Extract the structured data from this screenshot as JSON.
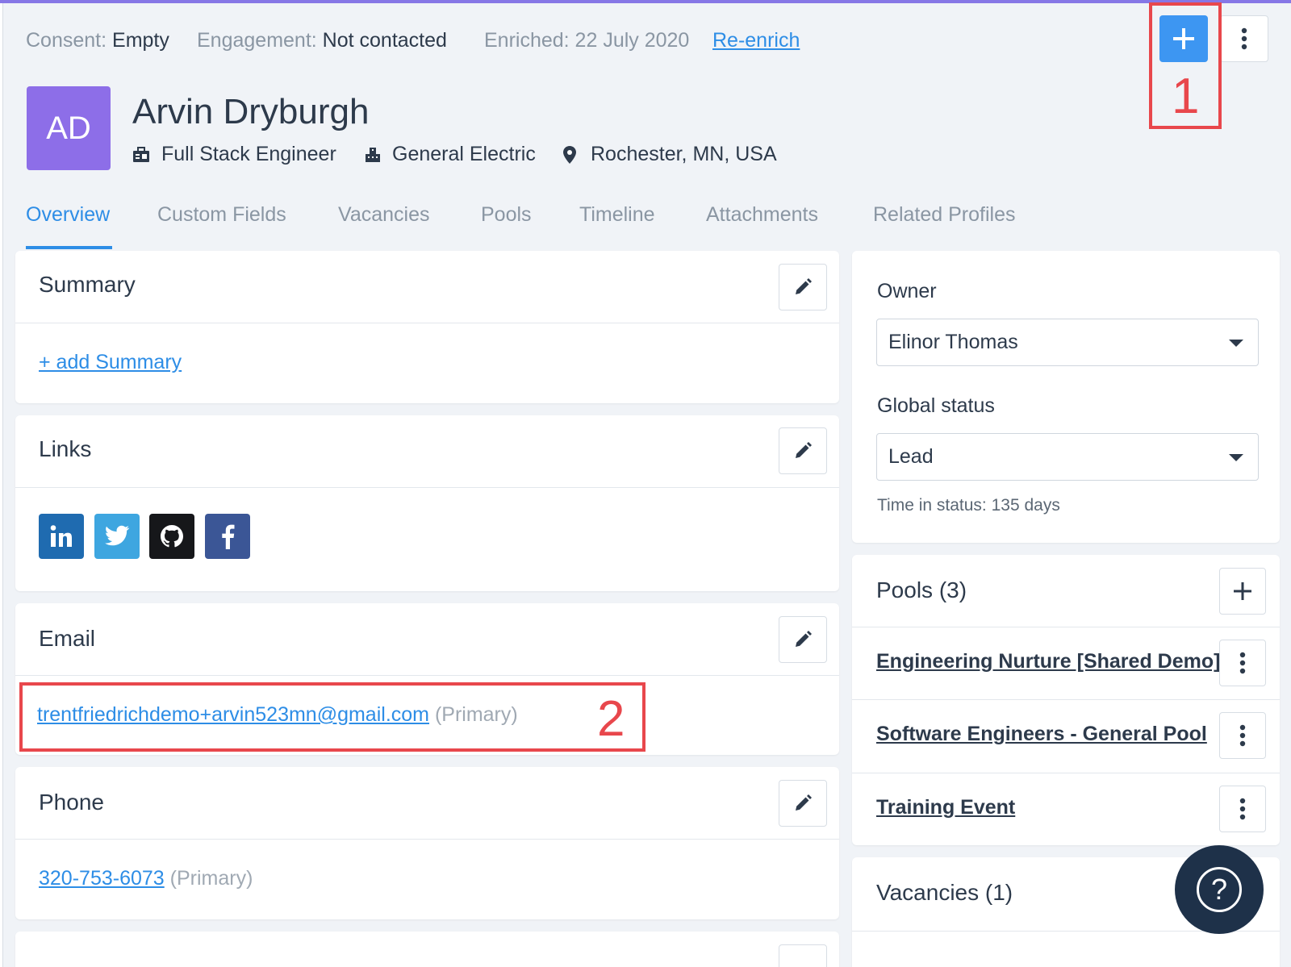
{
  "meta": {
    "consent_label": "Consent:",
    "consent_value": "Empty",
    "engagement_label": "Engagement:",
    "engagement_value": "Not contacted",
    "enriched_text": "Enriched: 22 July 2020",
    "reenrich_label": "Re-enrich"
  },
  "actions": {
    "add_icon": "plus-icon",
    "more_icon": "vertical-dots-icon"
  },
  "annotations": {
    "one": "1",
    "two": "2"
  },
  "profile": {
    "initials": "AD",
    "name": "Arvin Dryburgh",
    "title": "Full Stack Engineer",
    "company": "General Electric",
    "location": "Rochester, MN, USA"
  },
  "tabs": [
    "Overview",
    "Custom Fields",
    "Vacancies",
    "Pools",
    "Timeline",
    "Attachments",
    "Related Profiles"
  ],
  "summary": {
    "title": "Summary",
    "add_label": "+ add Summary"
  },
  "links": {
    "title": "Links",
    "items": [
      "linkedin-icon",
      "twitter-icon",
      "github-icon",
      "facebook-icon"
    ]
  },
  "email": {
    "title": "Email",
    "address": "trentfriedrichdemo+arvin523mn@gmail.com",
    "tag": "(Primary)"
  },
  "phone": {
    "title": "Phone",
    "number": "320-753-6073",
    "tag": "(Primary)"
  },
  "owner": {
    "label": "Owner",
    "value": "Elinor Thomas"
  },
  "global_status": {
    "label": "Global status",
    "value": "Lead",
    "time_in_status": "Time in status: 135 days"
  },
  "pools": {
    "title": "Pools (3)",
    "items": [
      "Engineering Nurture [Shared Demo]",
      "Software Engineers - General Pool",
      "Training Event"
    ]
  },
  "vacancies": {
    "title": "Vacancies (1)"
  },
  "colors": {
    "accent": "#2d8de6",
    "add_button": "#3d96f2",
    "avatar": "#8d6ee8",
    "annotation": "#e8474c"
  }
}
